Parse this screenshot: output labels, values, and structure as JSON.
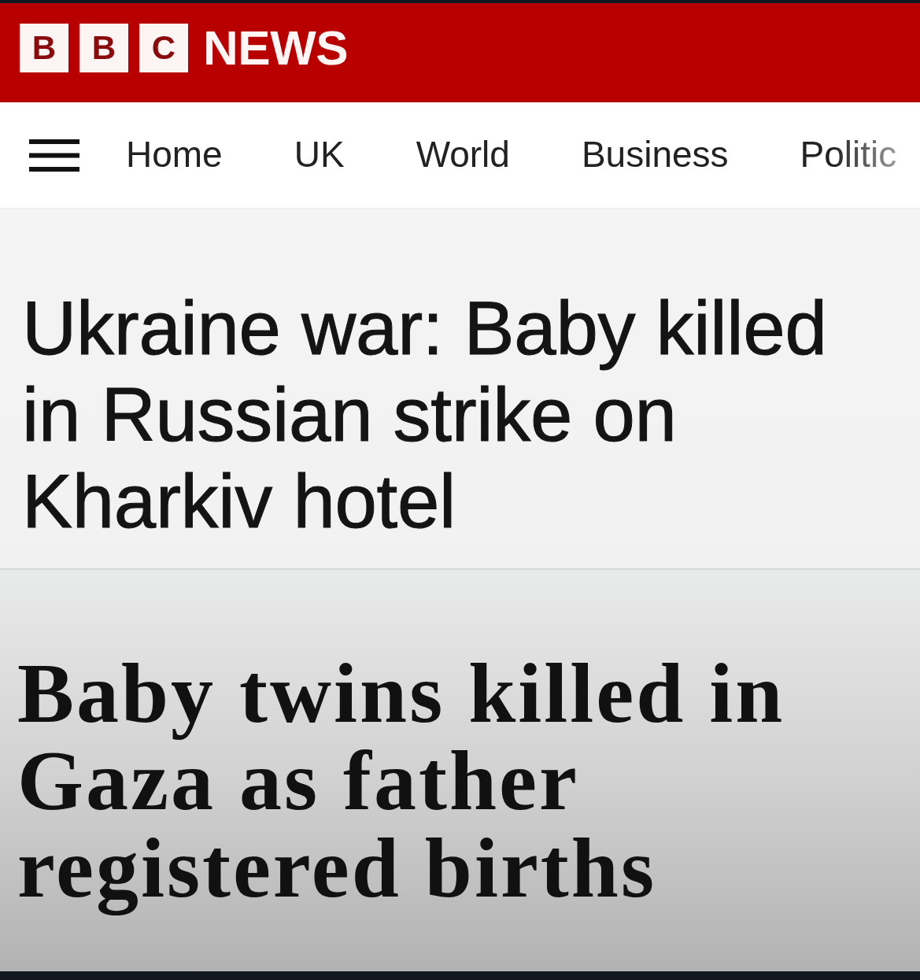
{
  "header": {
    "logo_letters": [
      "B",
      "B",
      "C"
    ],
    "title": "NEWS"
  },
  "nav": {
    "items": [
      {
        "label": "Home"
      },
      {
        "label": "UK"
      },
      {
        "label": "World"
      },
      {
        "label": "Business"
      },
      {
        "label": "Politic"
      }
    ]
  },
  "stories": [
    {
      "kind": "sans",
      "headline": "Ukraine war: Baby killed in Russian strike on Kharkiv hotel"
    },
    {
      "kind": "serif",
      "headline": "Baby twins killed in Gaza as father registered births"
    }
  ]
}
